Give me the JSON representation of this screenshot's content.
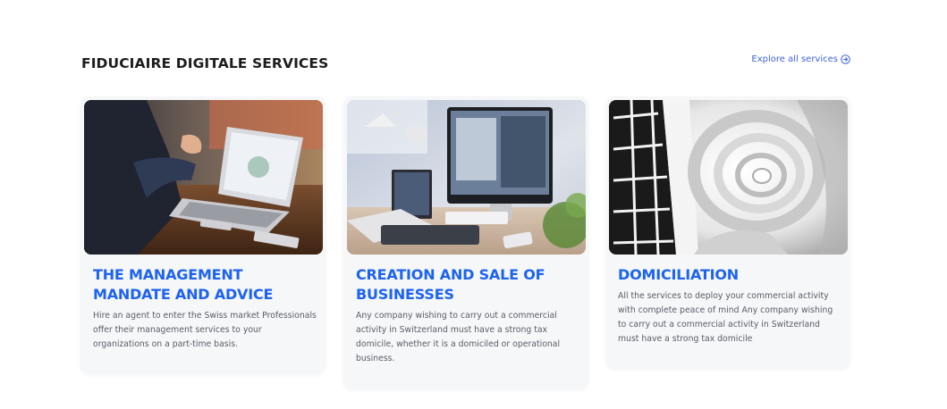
{
  "section": {
    "title": "FIDUCIAIRE DIGITALE SERVICES",
    "explore_label": "Explore all services",
    "explore_icon": "arrow-right-circle-icon"
  },
  "colors": {
    "accent": "#1d63f0",
    "link": "#3f63d8",
    "heading": "#1c1c1f",
    "card_bg": "#f6f7f9",
    "body_text": "#5b5b66"
  },
  "cards": [
    {
      "title": "THE MANAGEMENT MANDATE AND ADVICE",
      "text": "Hire an agent to enter the Swiss market Professionals offer their management services to your organizations on a part-time basis.",
      "image": "business-meeting-laptop-photo"
    },
    {
      "title": "CREATION AND SALE OF BUSINESSES",
      "text": "Any company wishing to carry out a commercial activity in Switzerland must have a strong tax domicile, whether it is a domiciled or operational business.",
      "image": "desk-computer-workspace-photo"
    },
    {
      "title": "DOMICILIATION",
      "text": "All the services to deploy your commercial activity with complete peace of mind Any company wishing to carry out a commercial activity in Switzerland must have a strong tax domicile",
      "image": "spiral-staircase-architecture-photo"
    }
  ]
}
